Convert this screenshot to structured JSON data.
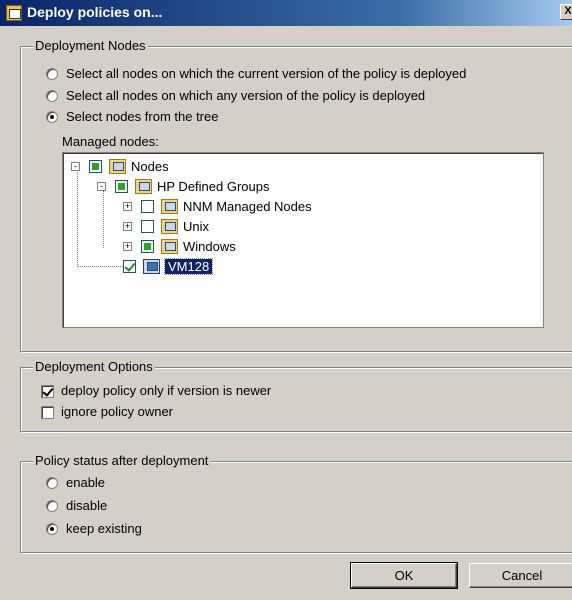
{
  "window": {
    "title": "Deploy policies on...",
    "close_glyph": "X"
  },
  "deployment_nodes": {
    "legend": "Deployment Nodes",
    "options": [
      {
        "label": "Select all nodes on which the current version of the policy is deployed",
        "selected": false
      },
      {
        "label": "Select all nodes on which any version of the policy is deployed",
        "selected": false
      },
      {
        "label": "Select nodes from the tree",
        "selected": true
      }
    ],
    "managed_nodes_label": "Managed nodes:",
    "tree": [
      {
        "label": "Nodes",
        "state": "partial",
        "expander": "-"
      },
      {
        "label": "HP Defined Groups",
        "state": "partial",
        "expander": "-"
      },
      {
        "label": "NNM Managed Nodes",
        "state": "unchecked",
        "expander": "+"
      },
      {
        "label": "Unix",
        "state": "unchecked",
        "expander": "+"
      },
      {
        "label": "Windows",
        "state": "partial",
        "expander": "+"
      },
      {
        "label": "VM128",
        "state": "checked",
        "expander": "",
        "selected": true
      }
    ]
  },
  "deployment_options": {
    "legend": "Deployment Options",
    "options": [
      {
        "label": "deploy policy only if version is newer",
        "checked": true
      },
      {
        "label": "ignore policy owner",
        "checked": false
      }
    ]
  },
  "policy_status": {
    "legend": "Policy status after deployment",
    "options": [
      {
        "label": "enable",
        "selected": false
      },
      {
        "label": "disable",
        "selected": false
      },
      {
        "label": "keep existing",
        "selected": true
      }
    ]
  },
  "buttons": {
    "ok": "OK",
    "cancel": "Cancel"
  }
}
